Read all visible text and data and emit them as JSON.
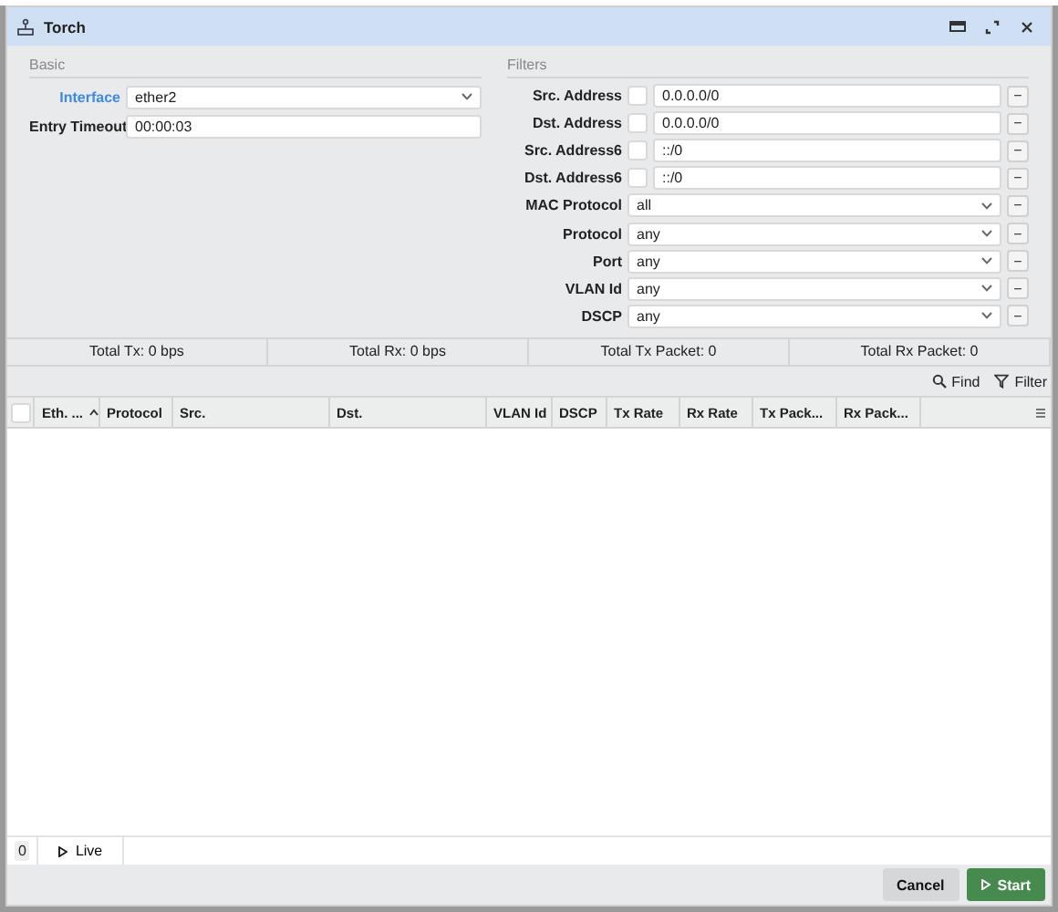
{
  "window": {
    "title": "Torch"
  },
  "basic": {
    "title": "Basic",
    "fields": [
      {
        "label": "Interface",
        "kind": "select",
        "value": "ether2",
        "link": true
      },
      {
        "label": "Entry Timeout",
        "kind": "text",
        "value": "00:00:03",
        "link": false
      }
    ]
  },
  "filters": {
    "title": "Filters",
    "fields": [
      {
        "label": "Src. Address",
        "kind": "text",
        "value": "0.0.0.0/0",
        "checked": false,
        "remove": "−"
      },
      {
        "label": "Dst. Address",
        "kind": "text",
        "value": "0.0.0.0/0",
        "checked": false,
        "remove": "−"
      },
      {
        "label": "Src. Address6",
        "kind": "text",
        "value": "::/0",
        "checked": false,
        "remove": "−"
      },
      {
        "label": "Dst. Address6",
        "kind": "text",
        "value": "::/0",
        "checked": false,
        "remove": "−"
      },
      {
        "label": "MAC Protocol",
        "kind": "select",
        "value": "all",
        "remove": "−"
      },
      {
        "label": "Protocol",
        "kind": "select",
        "value": "any",
        "remove": "−"
      },
      {
        "label": "Port",
        "kind": "select",
        "value": "any",
        "remove": "−"
      },
      {
        "label": "VLAN Id",
        "kind": "select",
        "value": "any",
        "remove": "−"
      },
      {
        "label": "DSCP",
        "kind": "select",
        "value": "any",
        "remove": "−"
      }
    ]
  },
  "totals": [
    "Total Tx: 0 bps",
    "Total Rx: 0 bps",
    "Total Tx Packet: 0",
    "Total Rx Packet: 0"
  ],
  "toolbar": {
    "find": "Find",
    "filter": "Filter"
  },
  "table": {
    "select_all": {
      "checked": false
    },
    "columns": [
      {
        "label": "Eth. ...",
        "sorted": true
      },
      {
        "label": "Protocol",
        "sorted": false
      },
      {
        "label": "Src.",
        "sorted": false
      },
      {
        "label": "Dst.",
        "sorted": false
      },
      {
        "label": "VLAN Id",
        "sorted": false
      },
      {
        "label": "DSCP",
        "sorted": false
      },
      {
        "label": "Tx Rate",
        "sorted": false
      },
      {
        "label": "Rx Rate",
        "sorted": false
      },
      {
        "label": "Tx Pack...",
        "sorted": false
      },
      {
        "label": "Rx Pack...",
        "sorted": false
      }
    ]
  },
  "footer": {
    "count": "0",
    "live": "Live"
  },
  "buttons": {
    "cancel": "Cancel",
    "start": "Start"
  }
}
